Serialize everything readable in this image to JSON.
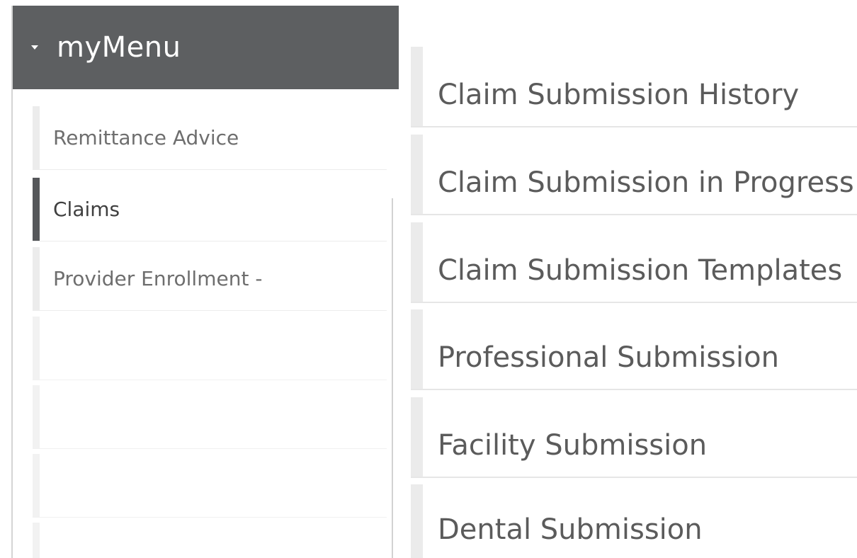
{
  "menu": {
    "title": "myMenu",
    "items": [
      {
        "label": "Remittance Advice",
        "active": false
      },
      {
        "label": "Claims",
        "active": true
      },
      {
        "label": "Provider Enrollment -",
        "active": false
      },
      {
        "label": "",
        "active": false
      },
      {
        "label": "",
        "active": false
      },
      {
        "label": "",
        "active": false
      },
      {
        "label": "",
        "active": false
      }
    ]
  },
  "submenu": {
    "items": [
      {
        "label": "Claim Submission History"
      },
      {
        "label": "Claim Submission in Progress"
      },
      {
        "label": "Claim Submission Templates"
      },
      {
        "label": "Professional Submission"
      },
      {
        "label": "Facility Submission"
      },
      {
        "label": "Dental Submission"
      }
    ]
  },
  "colors": {
    "header_bg": "#5d5f61",
    "active_marker": "#55575a",
    "inactive_marker": "#ececec"
  }
}
